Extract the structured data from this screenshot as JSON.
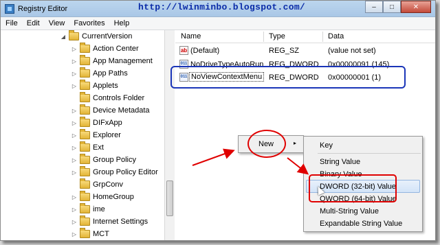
{
  "window": {
    "title": "Registry Editor",
    "blog_url": "http://lwinminbo.blogspot.com/",
    "minimize": "–",
    "maximize": "□",
    "close": "✕"
  },
  "menu": [
    "File",
    "Edit",
    "View",
    "Favorites",
    "Help"
  ],
  "tree": {
    "parent": "CurrentVersion",
    "items": [
      "Action Center",
      "App Management",
      "App Paths",
      "Applets",
      "Controls Folder",
      "Device Metadata",
      "DIFxApp",
      "Explorer",
      "Ext",
      "Group Policy",
      "Group Policy Editor",
      "GrpConv",
      "HomeGroup",
      "ime",
      "Internet Settings",
      "MCT"
    ]
  },
  "columns": {
    "name": "Name",
    "type": "Type",
    "data": "Data"
  },
  "values": [
    {
      "name": "(Default)",
      "type": "REG_SZ",
      "data": "(value not set)",
      "icon": "string-value-icon"
    },
    {
      "name": "NoDriveTypeAutoRun",
      "type": "REG_DWORD",
      "data": "0x00000091 (145)",
      "icon": "binary-value-icon"
    },
    {
      "name": "NoViewContextMenu",
      "type": "REG_DWORD",
      "data": "0x00000001 (1)",
      "icon": "binary-value-icon"
    }
  ],
  "context_menu": {
    "new": "New",
    "submenu_arrow": "▸"
  },
  "new_submenu": [
    "Key",
    "String Value",
    "Binary Value",
    "DWORD (32-bit) Value",
    "QWORD (64-bit) Value",
    "Multi-String Value",
    "Expandable String Value"
  ],
  "icons": {
    "string": "ab",
    "binary": "011",
    "collapsed": "▷",
    "expanded": "◢"
  },
  "colors": {
    "annotation_red": "#e00000",
    "annotation_blue": "#1a35b8",
    "url_blue": "#0a2ba8"
  }
}
